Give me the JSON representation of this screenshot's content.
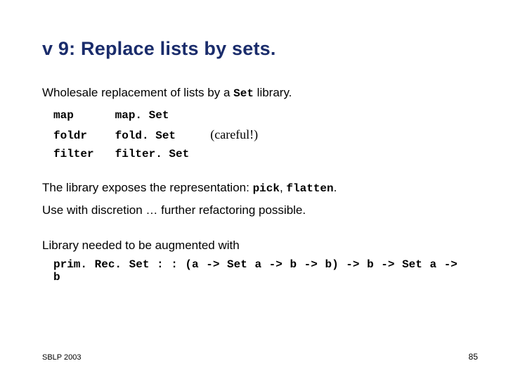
{
  "title": "v 9: Replace lists by sets.",
  "intro_prefix": "Wholesale replacement of lists by a ",
  "intro_code": "Set",
  "intro_suffix": " library.",
  "mapping": [
    {
      "from": "map",
      "to": "map. Set",
      "note": ""
    },
    {
      "from": "foldr",
      "to": "fold. Set",
      "note": "(careful!)"
    },
    {
      "from": "filter",
      "to": "filter. Set",
      "note": ""
    }
  ],
  "lib_prefix": "The library exposes the representation: ",
  "lib_code1": "pick",
  "lib_comma": ", ",
  "lib_code2": "flatten",
  "lib_period": ".",
  "discretion": "Use with discretion … further refactoring possible.",
  "augment": "Library needed to be augmented with",
  "code_line": "prim. Rec. Set : : (a -> Set a -> b -> b) -> b -> Set a -> b",
  "footer_left": "SBLP 2003",
  "footer_right": "85"
}
